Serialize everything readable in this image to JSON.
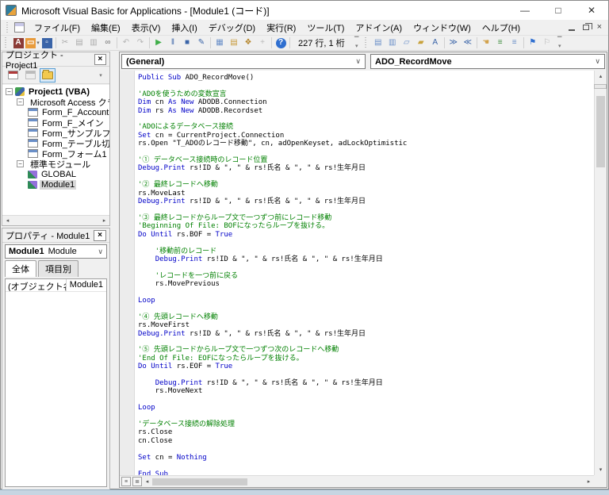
{
  "window": {
    "title": "Microsoft Visual Basic for Applications - [Module1 (コード)]",
    "controls": {
      "minimize": "—",
      "maximize": "□",
      "close": "✕"
    }
  },
  "menu": {
    "items": [
      "ファイル(F)",
      "編集(E)",
      "表示(V)",
      "挿入(I)",
      "デバッグ(D)",
      "実行(R)",
      "ツール(T)",
      "アドイン(A)",
      "ウィンドウ(W)",
      "ヘルプ(H)"
    ]
  },
  "toolbar": {
    "position_text": "227 行, 1 桁",
    "standard_icons": [
      {
        "name": "view-microsoft-access-icon",
        "glyph": "A",
        "color": "#ffffff",
        "bg": "#8c3b36"
      },
      {
        "name": "insert-module-icon",
        "glyph": "▭",
        "color": "#ffffff",
        "bg": "#e89b3c",
        "caret": true
      },
      {
        "name": "save-icon",
        "glyph": "▫",
        "color": "#ffffff",
        "bg": "#3a64a8"
      },
      {
        "name": "cut-icon",
        "glyph": "✂",
        "color": "#ababab",
        "sep_before": true
      },
      {
        "name": "copy-icon",
        "glyph": "▤",
        "color": "#ababab"
      },
      {
        "name": "paste-icon",
        "glyph": "▥",
        "color": "#ababab"
      },
      {
        "name": "find-icon",
        "glyph": "∞",
        "color": "#707070"
      },
      {
        "name": "undo-icon",
        "glyph": "↶",
        "color": "#b5b5b5",
        "sep_before": true
      },
      {
        "name": "redo-icon",
        "glyph": "↷",
        "color": "#b5b5b5"
      },
      {
        "name": "run-icon",
        "glyph": "▶",
        "color": "#3fae49",
        "sep_before": true
      },
      {
        "name": "break-icon",
        "glyph": "‖",
        "color": "#3a64a8"
      },
      {
        "name": "reset-icon",
        "glyph": "■",
        "color": "#3a64a8"
      },
      {
        "name": "design-mode-icon",
        "glyph": "✎",
        "color": "#3a64a8"
      },
      {
        "name": "project-explorer-icon",
        "glyph": "▦",
        "color": "#6a8fc8",
        "sep_before": true
      },
      {
        "name": "properties-window-icon",
        "glyph": "▤",
        "color": "#c89b3c"
      },
      {
        "name": "object-browser-icon",
        "glyph": "❖",
        "color": "#b5862c"
      },
      {
        "name": "toolbox-icon",
        "glyph": "+",
        "color": "#bbbbbb"
      },
      {
        "name": "help-icon",
        "glyph": "?",
        "color": "#ffffff",
        "bg": "#2f6fd0",
        "round": true,
        "sep_before": true
      }
    ],
    "edit_icons": [
      {
        "name": "list-properties-methods-icon",
        "glyph": "▤",
        "color": "#6a8fc8"
      },
      {
        "name": "list-constants-icon",
        "glyph": "▥",
        "color": "#6a8fc8"
      },
      {
        "name": "quick-info-icon",
        "glyph": "▱",
        "color": "#6a8fc8"
      },
      {
        "name": "parameter-info-icon",
        "glyph": "▰",
        "color": "#c8a23c"
      },
      {
        "name": "complete-word-icon",
        "glyph": "A",
        "color": "#3a64a8"
      },
      {
        "name": "indent-icon",
        "glyph": "≫",
        "color": "#3a64a8",
        "sep_before": true
      },
      {
        "name": "outdent-icon",
        "glyph": "≪",
        "color": "#3a64a8"
      },
      {
        "name": "toggle-breakpoint-icon",
        "glyph": "☚",
        "color": "#d2a24c",
        "sep_before": true
      },
      {
        "name": "comment-block-icon",
        "glyph": "≡",
        "color": "#3f8f3f"
      },
      {
        "name": "uncomment-block-icon",
        "glyph": "≡",
        "color": "#6a8fc8"
      },
      {
        "name": "toggle-bookmark-icon",
        "glyph": "⚑",
        "color": "#2f6fd0",
        "sep_before": true
      },
      {
        "name": "next-bookmark-icon",
        "glyph": "⚐",
        "color": "#b5b5b5"
      }
    ]
  },
  "project_panel": {
    "title": "プロジェクト - Project1",
    "close_label": "×",
    "tree": [
      {
        "level": 0,
        "icon": "vba",
        "label": "Project1 (VBA)",
        "expander": "-",
        "bold": true
      },
      {
        "level": 1,
        "icon": "folder",
        "label": "Microsoft Access クラ",
        "expander": "-"
      },
      {
        "level": 2,
        "icon": "form",
        "label": "Form_F_AccountCh"
      },
      {
        "level": 2,
        "icon": "form",
        "label": "Form_F_メイン"
      },
      {
        "level": 2,
        "icon": "form",
        "label": "Form_サンプルフォー"
      },
      {
        "level": 2,
        "icon": "form",
        "label": "Form_テーブル切替"
      },
      {
        "level": 2,
        "icon": "form",
        "label": "Form_フォーム1"
      },
      {
        "level": 1,
        "icon": "folder",
        "label": "標準モジュール",
        "expander": "-"
      },
      {
        "level": 2,
        "icon": "module",
        "label": "GLOBAL"
      },
      {
        "level": 2,
        "icon": "module",
        "label": "Module1",
        "selected": true
      }
    ]
  },
  "properties_panel": {
    "title": "プロパティ - Module1",
    "close_label": "×",
    "selector_name": "Module1",
    "selector_type": "Module",
    "tabs": [
      "全体",
      "項目別"
    ],
    "rows": [
      {
        "name": "(オブジェクト名)",
        "value": "Module1"
      }
    ]
  },
  "code_window": {
    "left_dropdown": "(General)",
    "right_dropdown": "ADO_RecordMove",
    "lines": [
      [
        [
          "k",
          "Public Sub"
        ],
        [
          "n",
          " ADO_RecordMove()"
        ]
      ],
      [],
      [
        [
          "c",
          "'ADOを使うための変数宣言"
        ]
      ],
      [
        [
          "k",
          "Dim"
        ],
        [
          "n",
          " cn "
        ],
        [
          "k",
          "As New"
        ],
        [
          "n",
          " ADODB.Connection"
        ]
      ],
      [
        [
          "k",
          "Dim"
        ],
        [
          "n",
          " rs "
        ],
        [
          "k",
          "As New"
        ],
        [
          "n",
          " ADODB.Recordset"
        ]
      ],
      [],
      [
        [
          "c",
          "'ADOによるデータベース接続"
        ]
      ],
      [
        [
          "k",
          "Set"
        ],
        [
          "n",
          " cn = CurrentProject.Connection"
        ]
      ],
      [
        [
          "n",
          "rs.Open \"T_ADOのレコード移動\", cn, adOpenKeyset, adLockOptimistic"
        ]
      ],
      [],
      [
        [
          "c",
          "'① データベース接続時のレコード位置"
        ]
      ],
      [
        [
          "k",
          "Debug.Print"
        ],
        [
          "n",
          " rs!ID & \", \" & rs!氏名 & \", \" & rs!生年月日"
        ]
      ],
      [],
      [
        [
          "c",
          "'② 最終レコードへ移動"
        ]
      ],
      [
        [
          "n",
          "rs.MoveLast"
        ]
      ],
      [
        [
          "k",
          "Debug.Print"
        ],
        [
          "n",
          " rs!ID & \", \" & rs!氏名 & \", \" & rs!生年月日"
        ]
      ],
      [],
      [
        [
          "c",
          "'③ 最終レコードからループ文で一つずつ前にレコード移動"
        ]
      ],
      [
        [
          "c",
          "'Beginning Of File: BOFになったらループを抜ける。"
        ]
      ],
      [
        [
          "k",
          "Do Until"
        ],
        [
          "n",
          " rs.BOF = "
        ],
        [
          "k",
          "True"
        ]
      ],
      [],
      [
        [
          "c",
          "    '移動前のレコード"
        ]
      ],
      [
        [
          "n",
          "    "
        ],
        [
          "k",
          "Debug.Print"
        ],
        [
          "n",
          " rs!ID & \", \" & rs!氏名 & \", \" & rs!生年月日"
        ]
      ],
      [],
      [
        [
          "c",
          "    'レコードを一つ前に戻る"
        ]
      ],
      [
        [
          "n",
          "    rs.MovePrevious"
        ]
      ],
      [],
      [
        [
          "k",
          "Loop"
        ]
      ],
      [],
      [
        [
          "c",
          "'④ 先頭レコードへ移動"
        ]
      ],
      [
        [
          "n",
          "rs.MoveFirst"
        ]
      ],
      [
        [
          "k",
          "Debug.Print"
        ],
        [
          "n",
          " rs!ID & \", \" & rs!氏名 & \", \" & rs!生年月日"
        ]
      ],
      [],
      [
        [
          "c",
          "'⑤ 先頭レコードからループ文で一つずつ次のレコードへ移動"
        ]
      ],
      [
        [
          "c",
          "'End Of File: EOFになったらループを抜ける。"
        ]
      ],
      [
        [
          "k",
          "Do Until"
        ],
        [
          "n",
          " rs.EOF = "
        ],
        [
          "k",
          "True"
        ]
      ],
      [],
      [
        [
          "n",
          "    "
        ],
        [
          "k",
          "Debug.Print"
        ],
        [
          "n",
          " rs!ID & \", \" & rs!氏名 & \", \" & rs!生年月日"
        ]
      ],
      [
        [
          "n",
          "    rs.MoveNext"
        ]
      ],
      [],
      [
        [
          "k",
          "Loop"
        ]
      ],
      [],
      [
        [
          "c",
          "'データベース接続の解除処理"
        ]
      ],
      [
        [
          "n",
          "rs.Close"
        ]
      ],
      [
        [
          "n",
          "cn.Close"
        ]
      ],
      [],
      [
        [
          "k",
          "Set"
        ],
        [
          "n",
          " cn = "
        ],
        [
          "k",
          "Nothing"
        ]
      ],
      [],
      [
        [
          "k",
          "End Sub"
        ]
      ]
    ]
  },
  "colors": {
    "keyword": "#0000c8",
    "comment": "#008000",
    "text": "#000000",
    "selection_bg": "#d9d9d9"
  }
}
